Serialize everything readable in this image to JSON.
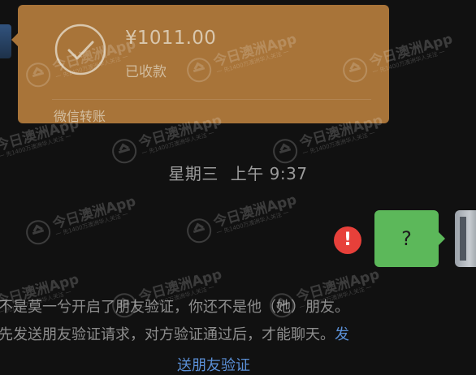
{
  "transfer_card": {
    "amount": "¥1011.00",
    "status": "已收款",
    "footer": "微信转账",
    "icon": "check-circle-icon",
    "color": "#a87439"
  },
  "timestamp": {
    "day": "星期三",
    "time": "上午 9:37"
  },
  "outgoing_message": {
    "text": "?",
    "bubble_color": "#5cb85a",
    "error_icon": "exclamation-icon",
    "error_glyph": "!",
    "error_color": "#e7403a"
  },
  "system_notice": {
    "line1": "不是莫一兮开启了朋友验证，你还不是他（她）朋友。",
    "line2_text": "先发送朋友验证请求，对方验证通过后，才能聊天。",
    "line2_link": "发",
    "line3": "送朋友验证",
    "link_color": "#5a8fd6"
  },
  "watermark": {
    "name": "今日澳洲App",
    "tagline": "一 先1400万澳洲华人关注 一"
  }
}
